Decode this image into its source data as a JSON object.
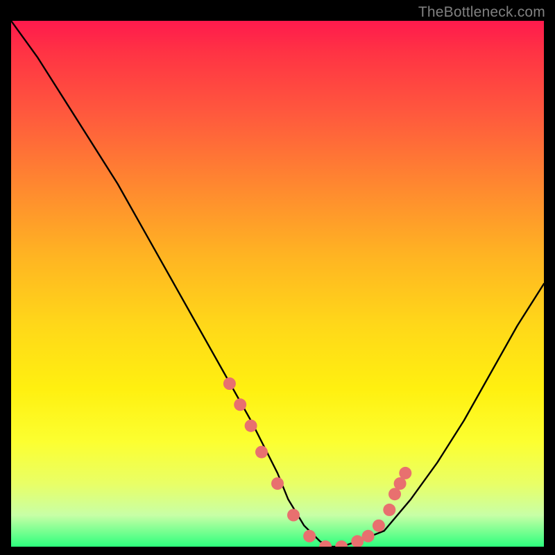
{
  "watermark": {
    "text": "TheBottleneck.com"
  },
  "chart_data": {
    "type": "line",
    "title": "",
    "xlabel": "",
    "ylabel": "",
    "xlim": [
      0,
      100
    ],
    "ylim": [
      0,
      100
    ],
    "series": [
      {
        "name": "bottleneck-curve",
        "x": [
          0,
          5,
          10,
          15,
          20,
          25,
          30,
          35,
          40,
          45,
          50,
          52,
          55,
          58,
          60,
          62,
          65,
          70,
          75,
          80,
          85,
          90,
          95,
          100
        ],
        "y": [
          100,
          93,
          85,
          77,
          69,
          60,
          51,
          42,
          33,
          24,
          14,
          9,
          4,
          1,
          0,
          0,
          1,
          3,
          9,
          16,
          24,
          33,
          42,
          50
        ]
      }
    ],
    "markers": {
      "name": "highlight-dots",
      "color": "#e8706f",
      "x": [
        41,
        43,
        45,
        47,
        50,
        53,
        56,
        59,
        62,
        65,
        67,
        69,
        71,
        72,
        73,
        74
      ],
      "y": [
        31,
        27,
        23,
        18,
        12,
        6,
        2,
        0,
        0,
        1,
        2,
        4,
        7,
        10,
        12,
        14
      ]
    },
    "gradient_stops": [
      {
        "pos": 0,
        "color": "#ff1a4d"
      },
      {
        "pos": 18,
        "color": "#ff5a3d"
      },
      {
        "pos": 45,
        "color": "#ffb522"
      },
      {
        "pos": 70,
        "color": "#fff010"
      },
      {
        "pos": 94,
        "color": "#c8ffa6"
      },
      {
        "pos": 100,
        "color": "#2dff7d"
      }
    ]
  }
}
